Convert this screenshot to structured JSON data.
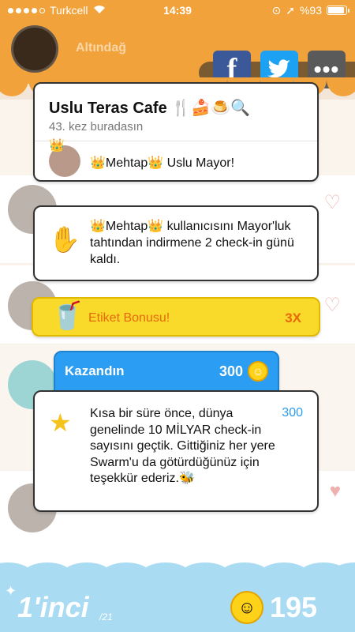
{
  "status": {
    "carrier": "Turkcell",
    "time": "14:39",
    "battery": "%93",
    "battery_level": 0.93
  },
  "header": {
    "user_name": "Altındağ",
    "share": {
      "facebook": "f",
      "twitter": "twitter-bird-icon",
      "more": "•••"
    }
  },
  "venue_card": {
    "title": "Uslu Teras Cafe 🍴🍰🍮🔍",
    "visits": "43. kez buradasın",
    "mayor_text": "👑Mehtap👑 Uslu Mayor!"
  },
  "mayor_progress_card": {
    "text": "👑Mehtap👑 kullanıcısını Mayor'luk tahtından indirmene 2 check-in günü kaldı."
  },
  "sticker_bonus": {
    "label": "Etiket Bonusu!",
    "multiplier": "3X"
  },
  "earned": {
    "label": "Kazandın",
    "amount": "300"
  },
  "milestone": {
    "text": "Kısa bir süre önce, dünya genelinde 10 MİLYAR check-in sayısını geçtik. Gittiğiniz her yere Swarm'u da götürdüğünüz için teşekkür ederiz.🐝",
    "amount": "300"
  },
  "bottom_bar": {
    "rank": "1'inci",
    "rank_total": "/21",
    "coins": "195"
  },
  "colors": {
    "header_orange": "#f2a23a",
    "bonus_yellow": "#f9d92a",
    "earned_blue": "#2b9df2",
    "bottom_blue": "#a9dbf2"
  }
}
